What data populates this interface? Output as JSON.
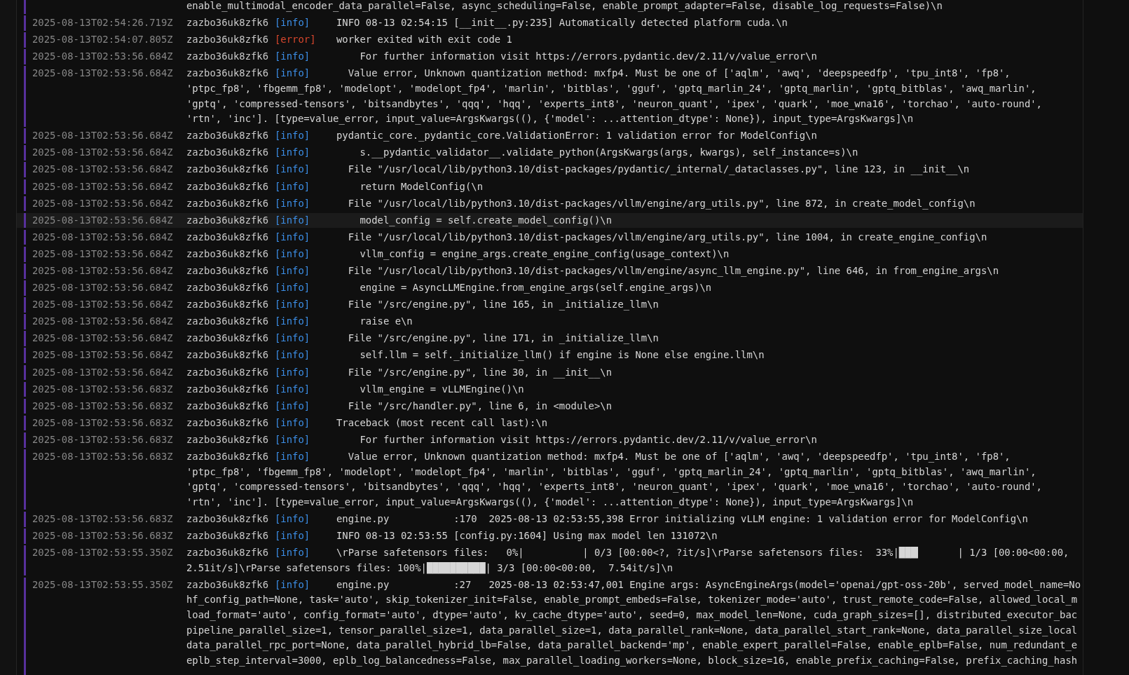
{
  "log": {
    "entries": [
      {
        "highlighted": false,
        "lines": [
          "enable_multimodal_encoder_data_parallel=False, async_scheduling=False, enable_prompt_adapter=False, disable_log_requests=False)\\n"
        ]
      },
      {
        "highlighted": false,
        "timestamp": "2025-08-13T02:54:26.719Z",
        "pod": "zazbo36uk8zfk6",
        "tag": "[info]",
        "kind": "info",
        "lines": [
          "INFO 08-13 02:54:15 [__init__.py:235] Automatically detected platform cuda.\\n"
        ]
      },
      {
        "highlighted": false,
        "timestamp": "2025-08-13T02:54:07.805Z",
        "pod": "zazbo36uk8zfk6",
        "tag": "[error]",
        "kind": "error",
        "lines": [
          "worker exited with exit code 1"
        ]
      },
      {
        "highlighted": false,
        "timestamp": "2025-08-13T02:53:56.684Z",
        "pod": "zazbo36uk8zfk6",
        "tag": "[info]",
        "kind": "info",
        "lines": [
          "    For further information visit https://errors.pydantic.dev/2.11/v/value_error\\n"
        ]
      },
      {
        "highlighted": false,
        "timestamp": "2025-08-13T02:53:56.684Z",
        "pod": "zazbo36uk8zfk6",
        "tag": "[info]",
        "kind": "info",
        "lines": [
          "  Value error, Unknown quantization method: mxfp4. Must be one of ['aqlm', 'awq', 'deepspeedfp', 'tpu_int8', 'fp8',",
          "'ptpc_fp8', 'fbgemm_fp8', 'modelopt', 'modelopt_fp4', 'marlin', 'bitblas', 'gguf', 'gptq_marlin_24', 'gptq_marlin', 'gptq_bitblas', 'awq_marlin',",
          "'gptq', 'compressed-tensors', 'bitsandbytes', 'qqq', 'hqq', 'experts_int8', 'neuron_quant', 'ipex', 'quark', 'moe_wna16', 'torchao', 'auto-round',",
          "'rtn', 'inc']. [type=value_error, input_value=ArgsKwargs((), {'model': ...attention_dtype': None}), input_type=ArgsKwargs]\\n"
        ]
      },
      {
        "highlighted": false,
        "timestamp": "2025-08-13T02:53:56.684Z",
        "pod": "zazbo36uk8zfk6",
        "tag": "[info]",
        "kind": "info",
        "lines": [
          "pydantic_core._pydantic_core.ValidationError: 1 validation error for ModelConfig\\n"
        ]
      },
      {
        "highlighted": false,
        "timestamp": "2025-08-13T02:53:56.684Z",
        "pod": "zazbo36uk8zfk6",
        "tag": "[info]",
        "kind": "info",
        "lines": [
          "    s.__pydantic_validator__.validate_python(ArgsKwargs(args, kwargs), self_instance=s)\\n"
        ]
      },
      {
        "highlighted": false,
        "timestamp": "2025-08-13T02:53:56.684Z",
        "pod": "zazbo36uk8zfk6",
        "tag": "[info]",
        "kind": "info",
        "lines": [
          "  File \"/usr/local/lib/python3.10/dist-packages/pydantic/_internal/_dataclasses.py\", line 123, in __init__\\n"
        ]
      },
      {
        "highlighted": false,
        "timestamp": "2025-08-13T02:53:56.684Z",
        "pod": "zazbo36uk8zfk6",
        "tag": "[info]",
        "kind": "info",
        "lines": [
          "    return ModelConfig(\\n"
        ]
      },
      {
        "highlighted": false,
        "timestamp": "2025-08-13T02:53:56.684Z",
        "pod": "zazbo36uk8zfk6",
        "tag": "[info]",
        "kind": "info",
        "lines": [
          "  File \"/usr/local/lib/python3.10/dist-packages/vllm/engine/arg_utils.py\", line 872, in create_model_config\\n"
        ]
      },
      {
        "highlighted": true,
        "timestamp": "2025-08-13T02:53:56.684Z",
        "pod": "zazbo36uk8zfk6",
        "tag": "[info]",
        "kind": "info",
        "lines": [
          "    model_config = self.create_model_config()\\n"
        ]
      },
      {
        "highlighted": false,
        "timestamp": "2025-08-13T02:53:56.684Z",
        "pod": "zazbo36uk8zfk6",
        "tag": "[info]",
        "kind": "info",
        "lines": [
          "  File \"/usr/local/lib/python3.10/dist-packages/vllm/engine/arg_utils.py\", line 1004, in create_engine_config\\n"
        ]
      },
      {
        "highlighted": false,
        "timestamp": "2025-08-13T02:53:56.684Z",
        "pod": "zazbo36uk8zfk6",
        "tag": "[info]",
        "kind": "info",
        "lines": [
          "    vllm_config = engine_args.create_engine_config(usage_context)\\n"
        ]
      },
      {
        "highlighted": false,
        "timestamp": "2025-08-13T02:53:56.684Z",
        "pod": "zazbo36uk8zfk6",
        "tag": "[info]",
        "kind": "info",
        "lines": [
          "  File \"/usr/local/lib/python3.10/dist-packages/vllm/engine/async_llm_engine.py\", line 646, in from_engine_args\\n"
        ]
      },
      {
        "highlighted": false,
        "timestamp": "2025-08-13T02:53:56.684Z",
        "pod": "zazbo36uk8zfk6",
        "tag": "[info]",
        "kind": "info",
        "lines": [
          "    engine = AsyncLLMEngine.from_engine_args(self.engine_args)\\n"
        ]
      },
      {
        "highlighted": false,
        "timestamp": "2025-08-13T02:53:56.684Z",
        "pod": "zazbo36uk8zfk6",
        "tag": "[info]",
        "kind": "info",
        "lines": [
          "  File \"/src/engine.py\", line 165, in _initialize_llm\\n"
        ]
      },
      {
        "highlighted": false,
        "timestamp": "2025-08-13T02:53:56.684Z",
        "pod": "zazbo36uk8zfk6",
        "tag": "[info]",
        "kind": "info",
        "lines": [
          "    raise e\\n"
        ]
      },
      {
        "highlighted": false,
        "timestamp": "2025-08-13T02:53:56.684Z",
        "pod": "zazbo36uk8zfk6",
        "tag": "[info]",
        "kind": "info",
        "lines": [
          "  File \"/src/engine.py\", line 171, in _initialize_llm\\n"
        ]
      },
      {
        "highlighted": false,
        "timestamp": "2025-08-13T02:53:56.684Z",
        "pod": "zazbo36uk8zfk6",
        "tag": "[info]",
        "kind": "info",
        "lines": [
          "    self.llm = self._initialize_llm() if engine is None else engine.llm\\n"
        ]
      },
      {
        "highlighted": false,
        "timestamp": "2025-08-13T02:53:56.684Z",
        "pod": "zazbo36uk8zfk6",
        "tag": "[info]",
        "kind": "info",
        "lines": [
          "  File \"/src/engine.py\", line 30, in __init__\\n"
        ]
      },
      {
        "highlighted": false,
        "timestamp": "2025-08-13T02:53:56.683Z",
        "pod": "zazbo36uk8zfk6",
        "tag": "[info]",
        "kind": "info",
        "lines": [
          "    vllm_engine = vLLMEngine()\\n"
        ]
      },
      {
        "highlighted": false,
        "timestamp": "2025-08-13T02:53:56.683Z",
        "pod": "zazbo36uk8zfk6",
        "tag": "[info]",
        "kind": "info",
        "lines": [
          "  File \"/src/handler.py\", line 6, in <module>\\n"
        ]
      },
      {
        "highlighted": false,
        "timestamp": "2025-08-13T02:53:56.683Z",
        "pod": "zazbo36uk8zfk6",
        "tag": "[info]",
        "kind": "info",
        "lines": [
          "Traceback (most recent call last):\\n"
        ]
      },
      {
        "highlighted": false,
        "timestamp": "2025-08-13T02:53:56.683Z",
        "pod": "zazbo36uk8zfk6",
        "tag": "[info]",
        "kind": "info",
        "lines": [
          "    For further information visit https://errors.pydantic.dev/2.11/v/value_error\\n"
        ]
      },
      {
        "highlighted": false,
        "timestamp": "2025-08-13T02:53:56.683Z",
        "pod": "zazbo36uk8zfk6",
        "tag": "[info]",
        "kind": "info",
        "lines": [
          "  Value error, Unknown quantization method: mxfp4. Must be one of ['aqlm', 'awq', 'deepspeedfp', 'tpu_int8', 'fp8',",
          "'ptpc_fp8', 'fbgemm_fp8', 'modelopt', 'modelopt_fp4', 'marlin', 'bitblas', 'gguf', 'gptq_marlin_24', 'gptq_marlin', 'gptq_bitblas', 'awq_marlin',",
          "'gptq', 'compressed-tensors', 'bitsandbytes', 'qqq', 'hqq', 'experts_int8', 'neuron_quant', 'ipex', 'quark', 'moe_wna16', 'torchao', 'auto-round',",
          "'rtn', 'inc']. [type=value_error, input_value=ArgsKwargs((), {'model': ...attention_dtype': None}), input_type=ArgsKwargs]\\n"
        ]
      },
      {
        "highlighted": false,
        "timestamp": "2025-08-13T02:53:56.683Z",
        "pod": "zazbo36uk8zfk6",
        "tag": "[info]",
        "kind": "info",
        "lines": [
          "engine.py           :170  2025-08-13 02:53:55,398 Error initializing vLLM engine: 1 validation error for ModelConfig\\n"
        ]
      },
      {
        "highlighted": false,
        "timestamp": "2025-08-13T02:53:56.683Z",
        "pod": "zazbo36uk8zfk6",
        "tag": "[info]",
        "kind": "info",
        "lines": [
          "INFO 08-13 02:53:55 [config.py:1604] Using max model len 131072\\n"
        ]
      },
      {
        "highlighted": false,
        "timestamp": "2025-08-13T02:53:55.350Z",
        "pod": "zazbo36uk8zfk6",
        "tag": "[info]",
        "kind": "info",
        "lines": [
          "\\rParse safetensors files:   0%|          | 0/3 [00:00<?, ?it/s]\\rParse safetensors files:  33%|███▎      | 1/3 [00:00<00:00,",
          "2.51it/s]\\rParse safetensors files: 100%|██████████| 3/3 [00:00<00:00,  7.54it/s]\\n"
        ]
      },
      {
        "highlighted": false,
        "timestamp": "2025-08-13T02:53:55.350Z",
        "pod": "zazbo36uk8zfk6",
        "tag": "[info]",
        "kind": "info",
        "lines": [
          "engine.py           :27   2025-08-13 02:53:47,001 Engine args: AsyncEngineArgs(model='openai/gpt-oss-20b', served_model_name=No",
          "hf_config_path=None, task='auto', skip_tokenizer_init=False, enable_prompt_embeds=False, tokenizer_mode='auto', trust_remote_code=False, allowed_local_m",
          "load_format='auto', config_format='auto', dtype='auto', kv_cache_dtype='auto', seed=0, max_model_len=None, cuda_graph_sizes=[], distributed_executor_bac",
          "pipeline_parallel_size=1, tensor_parallel_size=1, data_parallel_size=1, data_parallel_rank=None, data_parallel_start_rank=None, data_parallel_size_local",
          "data_parallel_rpc_port=None, data_parallel_hybrid_lb=False, data_parallel_backend='mp', enable_expert_parallel=False, enable_eplb=False, num_redundant_e",
          "eplb_step_interval=3000, eplb_log_balancedness=False, max_parallel_loading_workers=None, block_size=16, enable_prefix_caching=False, prefix_caching_hash"
        ]
      }
    ]
  }
}
